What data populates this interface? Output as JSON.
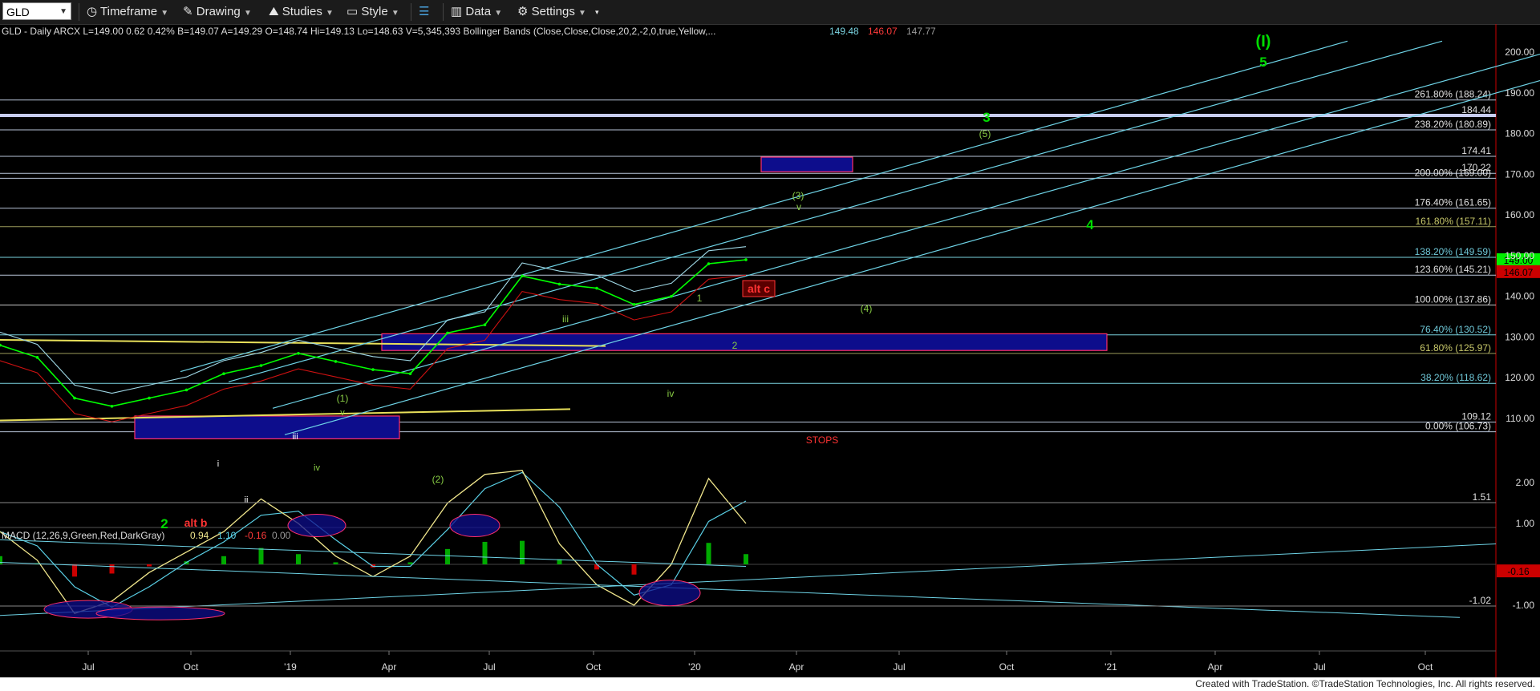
{
  "toolbar": {
    "symbol": "GLD",
    "timeframe_label": "Timeframe",
    "drawing_label": "Drawing",
    "studies_label": "Studies",
    "style_label": "Style",
    "data_label": "Data",
    "settings_label": "Settings"
  },
  "header_line": {
    "text": "GLD - Daily  ARCX  L=149.00  0.62  0.42%  B=149.07  A=149.29  O=148.74  Hi=149.13  Lo=148.63  V=5,345,393  Bollinger Bands (Close,Close,Close,20,2,-2,0,true,Yellow,...",
    "bb_values": [
      "149.48",
      "146.07",
      "147.77"
    ]
  },
  "macd_line": {
    "text": "MACD (12,26,9,Green,Red,DarkGray)",
    "values": [
      "0.94",
      "1.10",
      "-0.16",
      "0.00"
    ]
  },
  "footer": {
    "text": "Created with TradeStation. ©TradeStation Technologies, Inc. All rights reserved."
  },
  "colors": {
    "up": "#00ff00",
    "down": "#ff2222",
    "band_upper": "#9fd8e6",
    "band_lower": "#cc1111",
    "channel": "#6ed3e6",
    "fib": "#c8c8c8",
    "box": "#0d0d8c",
    "box_border": "#ff2f6b"
  },
  "chart_data": [
    {
      "type": "line",
      "title": "GLD - Daily",
      "x_ticks": [
        "Jul",
        "Oct",
        "'19",
        "Apr",
        "Jul",
        "Oct",
        "'20",
        "Apr",
        "Jul",
        "Oct",
        "'21",
        "Apr",
        "Jul",
        "Oct"
      ],
      "y_ticks": [
        110,
        120,
        130,
        140,
        150,
        160,
        170,
        180,
        190,
        200
      ],
      "ylim": [
        104,
        212
      ],
      "series": [
        {
          "name": "GLD",
          "x": [
            "2018-06",
            "2018-07",
            "2018-08",
            "2018-09",
            "2018-10",
            "2018-11",
            "2018-12",
            "2019-01",
            "2019-02",
            "2019-03",
            "2019-04",
            "2019-05",
            "2019-06",
            "2019-07",
            "2019-08",
            "2019-09",
            "2019-10",
            "2019-11",
            "2019-12",
            "2020-01",
            "2020-02"
          ],
          "values": [
            128,
            125,
            115,
            113,
            115,
            117,
            121,
            123,
            126,
            124,
            122,
            121,
            131,
            133,
            145,
            143,
            142,
            138,
            140,
            148,
            149
          ]
        }
      ],
      "price_labels": [
        {
          "value": 149.0,
          "text": "149.00",
          "color": "#00ee00"
        },
        {
          "value": 146.07,
          "text": "146.07",
          "color": "#cc0000"
        }
      ],
      "fib_levels": [
        {
          "value": 188.24,
          "text": "261.80% (188.24)"
        },
        {
          "value": 184.44,
          "text": "184.44"
        },
        {
          "value": 180.89,
          "text": "238.20% (180.89)"
        },
        {
          "value": 174.41,
          "text": "174.41"
        },
        {
          "value": 170.22,
          "text": "170.22"
        },
        {
          "value": 169.0,
          "text": "200.00% (169.00)"
        },
        {
          "value": 161.65,
          "text": "176.40% (161.65)"
        },
        {
          "value": 157.11,
          "text": "161.80% (157.11)"
        },
        {
          "value": 149.59,
          "text": "138.20% (149.59)"
        },
        {
          "value": 145.21,
          "text": "123.60% (145.21)"
        },
        {
          "value": 137.86,
          "text": "100.00% (137.86)"
        },
        {
          "value": 130.52,
          "text": "76.40% (130.52)"
        },
        {
          "value": 125.97,
          "text": "61.80% (125.97)"
        },
        {
          "value": 118.62,
          "text": "38.20% (118.62)"
        },
        {
          "value": 109.12,
          "text": "109.12"
        },
        {
          "value": 106.73,
          "text": "0.00% (106.73)"
        }
      ],
      "wave_labels": [
        {
          "text": "(I)",
          "color": "#00dd00"
        },
        {
          "text": "5",
          "color": "#00dd00"
        },
        {
          "text": "3",
          "color": "#00dd00"
        },
        {
          "text": "(5)",
          "color": "#88cc44"
        },
        {
          "text": "4",
          "color": "#00dd00"
        },
        {
          "text": "(3)",
          "color": "#88cc44"
        },
        {
          "text": "v",
          "color": "#88cc44"
        },
        {
          "text": "alt c",
          "color": "#ff3333"
        },
        {
          "text": "1",
          "color": "#88cc44"
        },
        {
          "text": "2",
          "color": "#88cc44"
        },
        {
          "text": "(4)",
          "color": "#88cc44"
        },
        {
          "text": "iii",
          "color": "#88cc44"
        },
        {
          "text": "iv",
          "color": "#88cc44"
        },
        {
          "text": "(1)",
          "color": "#88cc44"
        },
        {
          "text": "v",
          "color": "#88cc44"
        },
        {
          "text": "iii",
          "color": "#ffffff"
        },
        {
          "text": "iv",
          "color": "#88cc44"
        },
        {
          "text": "(2)",
          "color": "#88cc44"
        },
        {
          "text": "i",
          "color": "#ffffff"
        },
        {
          "text": "ii",
          "color": "#ffffff"
        },
        {
          "text": "2",
          "color": "#00dd00"
        },
        {
          "text": "alt b",
          "color": "#ff3333"
        },
        {
          "text": "STOPS",
          "color": "#ff3333"
        }
      ]
    },
    {
      "type": "line",
      "title": "MACD (12,26,9,Green,Red,DarkGray)",
      "y_ticks": [
        -1.0,
        1.0,
        2.0
      ],
      "ylim": [
        -1.45,
        2.45
      ],
      "series": [
        {
          "name": "MACD",
          "values": [
            0.8,
            0.1,
            -1.2,
            -0.9,
            -0.2,
            0.3,
            0.8,
            1.6,
            1.0,
            0.2,
            -0.3,
            0.2,
            1.5,
            2.2,
            2.3,
            0.5,
            -0.5,
            -1.0,
            0.0,
            2.1,
            1.0
          ]
        }
      ],
      "value_labels": [
        {
          "value": 1.51,
          "text": "1.51"
        },
        {
          "value": -0.16,
          "text": "-0.16"
        },
        {
          "value": -1.02,
          "text": "-1.02"
        }
      ]
    }
  ]
}
